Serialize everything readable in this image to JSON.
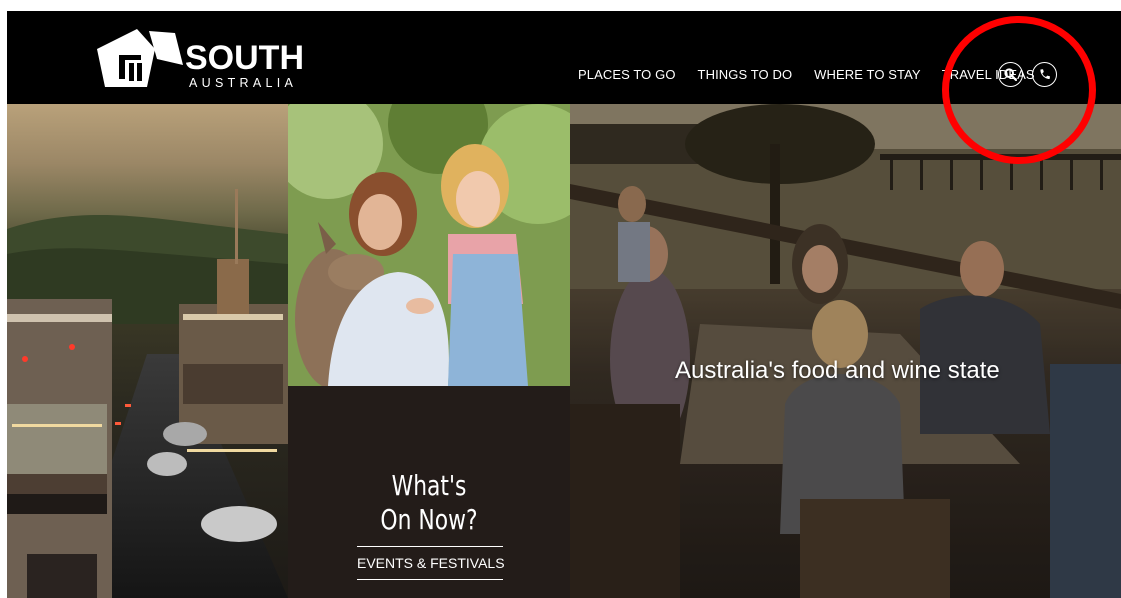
{
  "logo": {
    "name": "SOUTH",
    "sub": "AUSTRALIA"
  },
  "nav": {
    "items": [
      {
        "label": "PLACES TO GO"
      },
      {
        "label": "THINGS TO DO"
      },
      {
        "label": "WHERE TO STAY"
      },
      {
        "label": "TRAVEL IDEAS"
      }
    ]
  },
  "icons": {
    "search": "search-icon",
    "phone": "phone-icon"
  },
  "tiles": {
    "food": {
      "headline": "Australia's food and wine state"
    },
    "events": {
      "heading_line1": "What's",
      "heading_line2": "On Now?",
      "link": "EVENTS & FESTIVALS"
    }
  },
  "annotation": {
    "color": "#ff0000"
  },
  "colors": {
    "header_bg": "#000000",
    "events_bg": "#231c19"
  }
}
